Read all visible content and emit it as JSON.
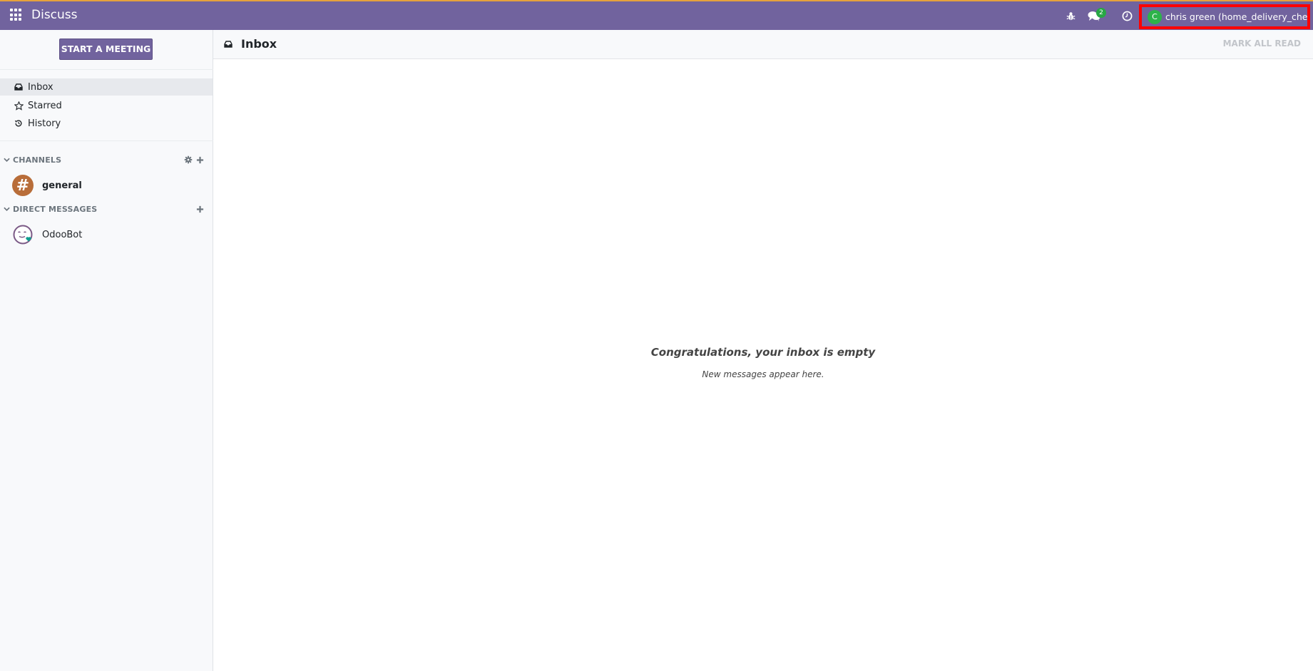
{
  "navbar": {
    "app_name": "Discuss",
    "apps_icon": "grid-icon",
    "debug_icon": "bug-icon",
    "messaging_icon": "comments-icon",
    "messaging_count": "2",
    "activity_icon": "clock-icon",
    "user_initial": "C",
    "user_name": "chris green (home_delivery_check)",
    "brand_color": "#71639e"
  },
  "sidebar": {
    "start_meeting": "START A MEETING",
    "mailboxes": [
      {
        "label": "Inbox",
        "icon": "inbox-icon",
        "active": true
      },
      {
        "label": "Starred",
        "icon": "star-icon",
        "active": false
      },
      {
        "label": "History",
        "icon": "history-icon",
        "active": false
      }
    ],
    "channels_header": "CHANNELS",
    "channels": [
      {
        "name": "general",
        "avatar": "#",
        "avatar_color": "#b86d39"
      }
    ],
    "dm_header": "DIRECT MESSAGES",
    "direct_messages": [
      {
        "name": "OdooBot"
      }
    ]
  },
  "main": {
    "title": "Inbox",
    "mark_all_read": "MARK ALL READ",
    "empty_title": "Congratulations, your inbox is empty",
    "empty_subtitle": "New messages appear here."
  }
}
